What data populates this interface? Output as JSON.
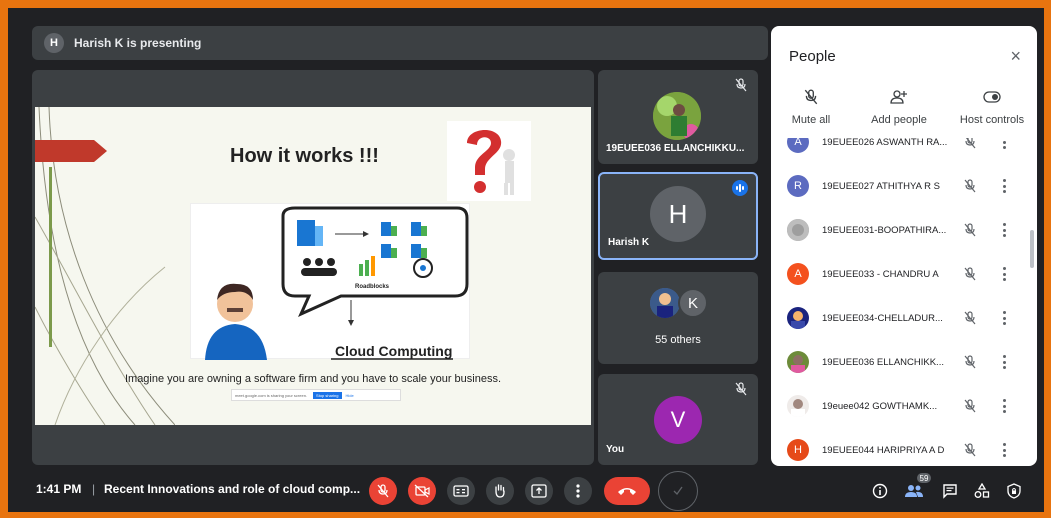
{
  "presenting_banner": {
    "avatar_letter": "H",
    "text": "Harish K is presenting"
  },
  "slide": {
    "title": "How it works !!!",
    "diagram_label_roadblocks": "Roadblocks",
    "diagram_label_cloud": "Cloud Computing",
    "caption": "Imagine you are owning a software firm and you have to scale your business.",
    "share_notice": "meet.google.com is sharing your screen.",
    "stop_sharing": "Stop sharing",
    "hide": "Hide"
  },
  "tiles": [
    {
      "name": "19EUEE036 ELLANCHIKKU...",
      "muted": true
    },
    {
      "name": "Harish K",
      "letter": "H",
      "speaking": true
    },
    {
      "name": "55 others",
      "letter": "K"
    },
    {
      "name": "You",
      "letter": "V",
      "muted": true
    }
  ],
  "people_panel": {
    "title": "People",
    "close_label": "×",
    "actions": [
      {
        "label": "Mute all",
        "icon": "mute-mic-icon"
      },
      {
        "label": "Add people",
        "icon": "add-person-icon"
      },
      {
        "label": "Host controls",
        "icon": "toggle-icon"
      }
    ],
    "participants": [
      {
        "letter": "A",
        "name": "19EUEE026 ASWANTH RA...",
        "color": "#5c6bc0"
      },
      {
        "letter": "R",
        "name": "19EUEE027 ATHITHYA R S",
        "color": "#5c6bc0"
      },
      {
        "letter": "",
        "name": "19EUEE031-BOOPATHIRA...",
        "color": "#9e9e9e"
      },
      {
        "letter": "A",
        "name": "19EUEE033 - CHANDRU A",
        "color": "#f4511e"
      },
      {
        "letter": "",
        "name": "19EUEE034-CHELLADUR...",
        "color": "#3f51b5"
      },
      {
        "letter": "",
        "name": "19EUEE036 ELLANCHIKK...",
        "color": "#8d6e63"
      },
      {
        "letter": "",
        "name": "19euee042 GOWTHAMK...",
        "color": "#bcaaa4"
      },
      {
        "letter": "H",
        "name": "19EUEE044 HARIPRIYA A D",
        "color": "#e64a19"
      }
    ]
  },
  "bottom_bar": {
    "time": "1:41 PM",
    "separator": "|",
    "meeting_title": "Recent Innovations and role of cloud comp...",
    "participant_count": "59"
  },
  "colors": {
    "accent_red": "#ea4335",
    "highlight_blue": "#8ab4f8",
    "frame_orange": "#e8740f"
  }
}
